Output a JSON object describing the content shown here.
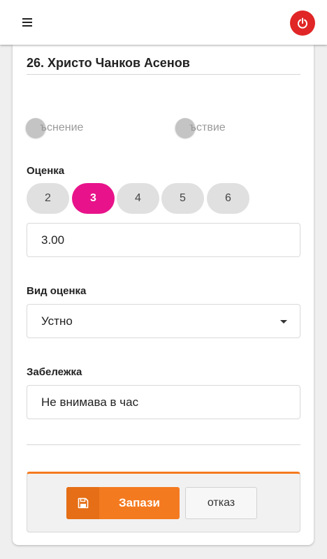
{
  "header": {
    "menu_icon": "hamburger-menu-icon",
    "power_icon": "power-icon",
    "power_color": "#e02626"
  },
  "student": {
    "name": "26. Христо Чанков Асенов"
  },
  "attendance": {
    "late_label": "ъснение",
    "absence_label": "ъствие"
  },
  "grade": {
    "label": "Оценка",
    "options": [
      "2",
      "3",
      "4",
      "5",
      "6"
    ],
    "selected": "3",
    "value": "3.00",
    "active_color": "#e8138a"
  },
  "grade_type": {
    "label": "Вид оценка",
    "selected": "Устно"
  },
  "note": {
    "label": "Забележка",
    "value": "Не внимава в час"
  },
  "actions": {
    "save_label": "Запази",
    "save_icon": "floppy-disk-icon",
    "cancel_label": "отказ",
    "accent_color": "#f47a20"
  }
}
